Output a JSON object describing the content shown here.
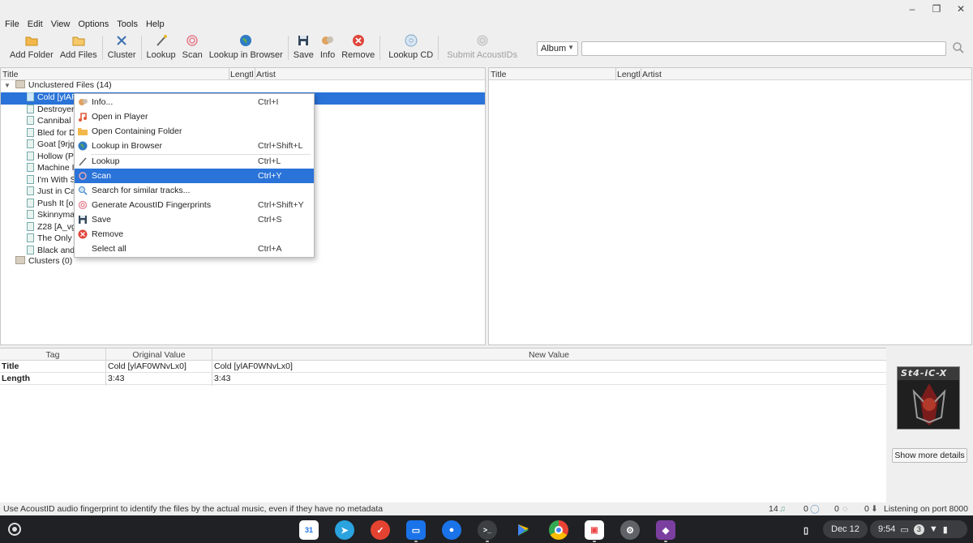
{
  "window_controls": [
    "–",
    "❐",
    "✕"
  ],
  "menubar": [
    "File",
    "Edit",
    "View",
    "Options",
    "Tools",
    "Help"
  ],
  "toolbar": [
    {
      "label": "Add Folder",
      "icon": "folder-icon"
    },
    {
      "label": "Add Files",
      "icon": "file-icon"
    },
    {
      "label": "Cluster",
      "icon": "cluster-icon"
    },
    {
      "label": "Lookup",
      "icon": "wand-icon"
    },
    {
      "label": "Scan",
      "icon": "fingerprint-icon"
    },
    {
      "label": "Lookup in Browser",
      "icon": "globe-icon"
    },
    {
      "label": "Save",
      "icon": "floppy-icon"
    },
    {
      "label": "Info",
      "icon": "info-icon"
    },
    {
      "label": "Remove",
      "icon": "remove-icon"
    },
    {
      "label": "Lookup CD",
      "icon": "cd-icon"
    },
    {
      "label": "Submit AcoustIDs",
      "icon": "submit-fingerprint-icon"
    }
  ],
  "search": {
    "type_value": "Album",
    "query": ""
  },
  "left_pane": {
    "columns": [
      "Title",
      "Lengtl",
      "Artist"
    ],
    "root": "Unclustered Files (14)",
    "files": [
      "Cold [ylAF",
      "Destroyer",
      "Cannibal [",
      "Bled for D",
      "Goat [9rjg",
      "Hollow (P",
      "Machine I",
      "I'm With S",
      "Just in Ca",
      "Push It [o",
      "Skinnyma",
      "Z28 [A_vg",
      "The Only |",
      "Black and"
    ],
    "clusters": "Clusters (0)"
  },
  "right_pane": {
    "columns": [
      "Title",
      "Lengtl",
      "Artist"
    ]
  },
  "context_menu": [
    {
      "label": "Info...",
      "shortcut": "Ctrl+I",
      "icon": "info-icon"
    },
    {
      "label": "Open in Player",
      "shortcut": "",
      "icon": "music-note-icon"
    },
    {
      "label": "Open Containing Folder",
      "shortcut": "",
      "icon": "folder-icon"
    },
    {
      "label": "Lookup in Browser",
      "shortcut": "Ctrl+Shift+L",
      "icon": "globe-icon"
    },
    {
      "label": "Lookup",
      "shortcut": "Ctrl+L",
      "icon": "wand-icon"
    },
    {
      "label": "Scan",
      "shortcut": "Ctrl+Y",
      "icon": "fingerprint-icon"
    },
    {
      "label": "Search for similar tracks...",
      "shortcut": "",
      "icon": "search-icon"
    },
    {
      "label": "Generate AcoustID Fingerprints",
      "shortcut": "Ctrl+Shift+Y",
      "icon": "fingerprint-icon"
    },
    {
      "label": "Save",
      "shortcut": "Ctrl+S",
      "icon": "floppy-icon"
    },
    {
      "label": "Remove",
      "shortcut": "",
      "icon": "remove-icon"
    },
    {
      "label": "Select all",
      "shortcut": "Ctrl+A",
      "icon": ""
    }
  ],
  "tag_table": {
    "columns": [
      "Tag",
      "Original Value",
      "New Value"
    ],
    "rows": [
      {
        "tag": "Title",
        "original": "Cold [ylAF0WNvLx0]",
        "new": "Cold [ylAF0WNvLx0]"
      },
      {
        "tag": "Length",
        "original": "3:43",
        "new": "3:43"
      }
    ]
  },
  "cover": {
    "title": "St4-iC-X"
  },
  "show_more": "Show more details",
  "status": {
    "message": "Use AcoustID audio fingerprint to identify the files by the actual music, even if they have no metadata",
    "files": "14",
    "albums": "0",
    "pending": "0",
    "requests": "0",
    "port": "Listening on port 8000"
  },
  "shelf": {
    "date": "Dec 12",
    "time": "9:54",
    "notif_count": "3",
    "calendar_day": "31"
  },
  "colors": {
    "selection": "#2a73d8",
    "shelf": "#202124"
  }
}
